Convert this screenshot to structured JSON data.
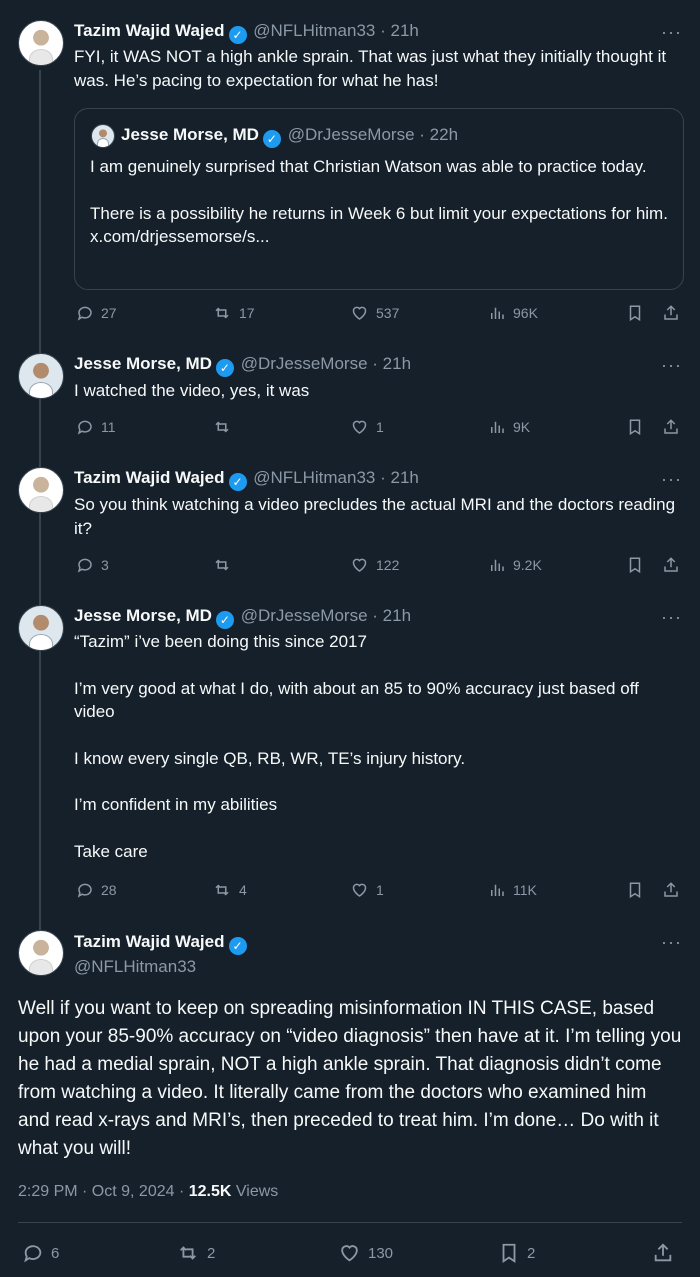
{
  "tweets": [
    {
      "name": "Tazim Wajid Wajed",
      "handle": "@NFLHitman33",
      "time": "21h",
      "text": "FYI, it WAS NOT a high ankle sprain.  That was just what they initially thought it was.  He’s pacing to expectation for what he has!",
      "quote": {
        "name": "Jesse Morse, MD",
        "handle": "@DrJesseMorse",
        "time": "22h",
        "line1": "I am genuinely surprised that Christian Watson was able to practice today.",
        "line2": "There is a possibility he returns in Week 6 but limit your expectations for him. x.com/drjessemorse/s..."
      },
      "replies": "27",
      "reposts": "17",
      "likes": "537",
      "views": "96K"
    },
    {
      "name": "Jesse Morse, MD",
      "handle": "@DrJesseMorse",
      "time": "21h",
      "text": "I watched the video, yes, it was",
      "replies": "11",
      "reposts": "",
      "likes": "1",
      "views": "9K"
    },
    {
      "name": "Tazim Wajid Wajed",
      "handle": "@NFLHitman33",
      "time": "21h",
      "text": "So you think watching a video precludes the actual MRI and the doctors reading it?",
      "replies": "3",
      "reposts": "",
      "likes": "122",
      "views": "9.2K"
    },
    {
      "name": "Jesse Morse, MD",
      "handle": "@DrJesseMorse",
      "time": "21h",
      "paragraphs": [
        "“Tazim” i’ve been doing this since 2017",
        "I’m very good at what I do, with about an 85 to 90% accuracy just based off video",
        "I know every single QB, RB, WR, TE’s injury history.",
        "I’m confident in my abilities",
        "Take care"
      ],
      "replies": "28",
      "reposts": "4",
      "likes": "1",
      "views": "11K"
    }
  ],
  "main": {
    "name": "Tazim Wajid Wajed",
    "handle": "@NFLHitman33",
    "text": "Well if you want to keep on spreading misinformation IN THIS CASE, based upon your 85-90% accuracy on “video diagnosis” then have at it.  I’m telling you he had a medial sprain, NOT a high ankle sprain.  That diagnosis didn’t come from watching a video.  It literally came from the doctors who examined him and read x-rays and MRI’s, then preceded to treat him.  I’m done… Do with it what you will!",
    "timestamp": "2:29 PM · Oct 9, 2024 · ",
    "views_count": "12.5K",
    "views_label": " Views",
    "replies": "6",
    "reposts": "2",
    "likes": "130",
    "bookmarks": "2"
  },
  "ui": {
    "more": "···",
    "dot": "·",
    "verified": "✓"
  },
  "colors": {
    "background": "#15202b",
    "text": "#f7f9f9",
    "muted": "#8b98a5",
    "verified": "#1d9bf0",
    "border": "#38444d"
  },
  "icons": [
    "reply-icon",
    "repost-icon",
    "like-icon",
    "views-icon",
    "bookmark-icon",
    "share-icon",
    "verified-badge-icon",
    "more-icon"
  ]
}
